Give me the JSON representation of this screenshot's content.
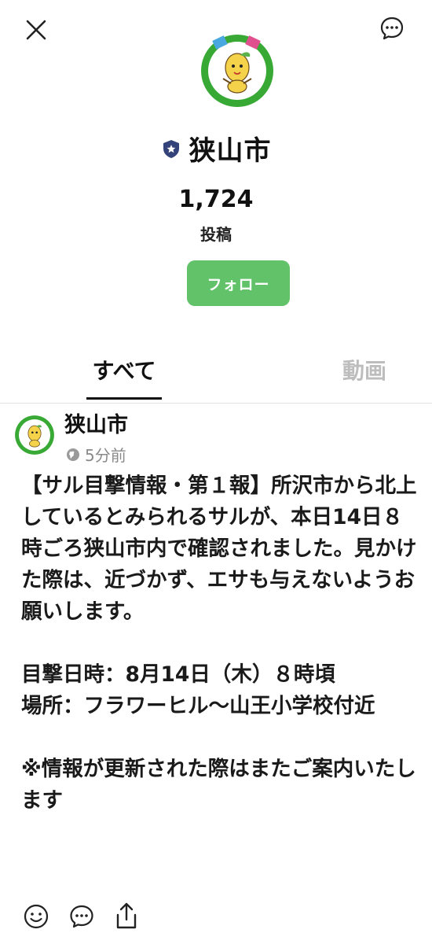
{
  "header": {
    "close_icon": "close-icon",
    "menu_icon": "chat-bubble-more-icon"
  },
  "profile": {
    "avatar_icon": "mascot-avatar",
    "avatar_ring_color": "#39a935",
    "verified_icon": "shield-star-icon",
    "name": "狭山市",
    "post_count": "1,724",
    "post_count_label": "投稿",
    "follow_label": "フォロー",
    "follow_color": "#62c26a"
  },
  "tabs": [
    {
      "label": "すべて",
      "active": true
    },
    {
      "label": "動画",
      "active": false
    }
  ],
  "post": {
    "author": "狭山市",
    "visibility_icon": "globe-icon",
    "time": "5分前",
    "body": "【サル目撃情報・第１報】所沢市から北上しているとみられるサルが、本日14日８時ごろ狭山市内で確認されました。見かけた際は、近づかず、エサも与えないようお願いします。\n\n目撃日時：8月14日（木）８時頃\n場所：フラワーヒル～山王小学校付近\n\n※情報が更新された際はまたご案内いたします",
    "actions": [
      "smile-icon",
      "comment-icon",
      "share-icon"
    ]
  }
}
